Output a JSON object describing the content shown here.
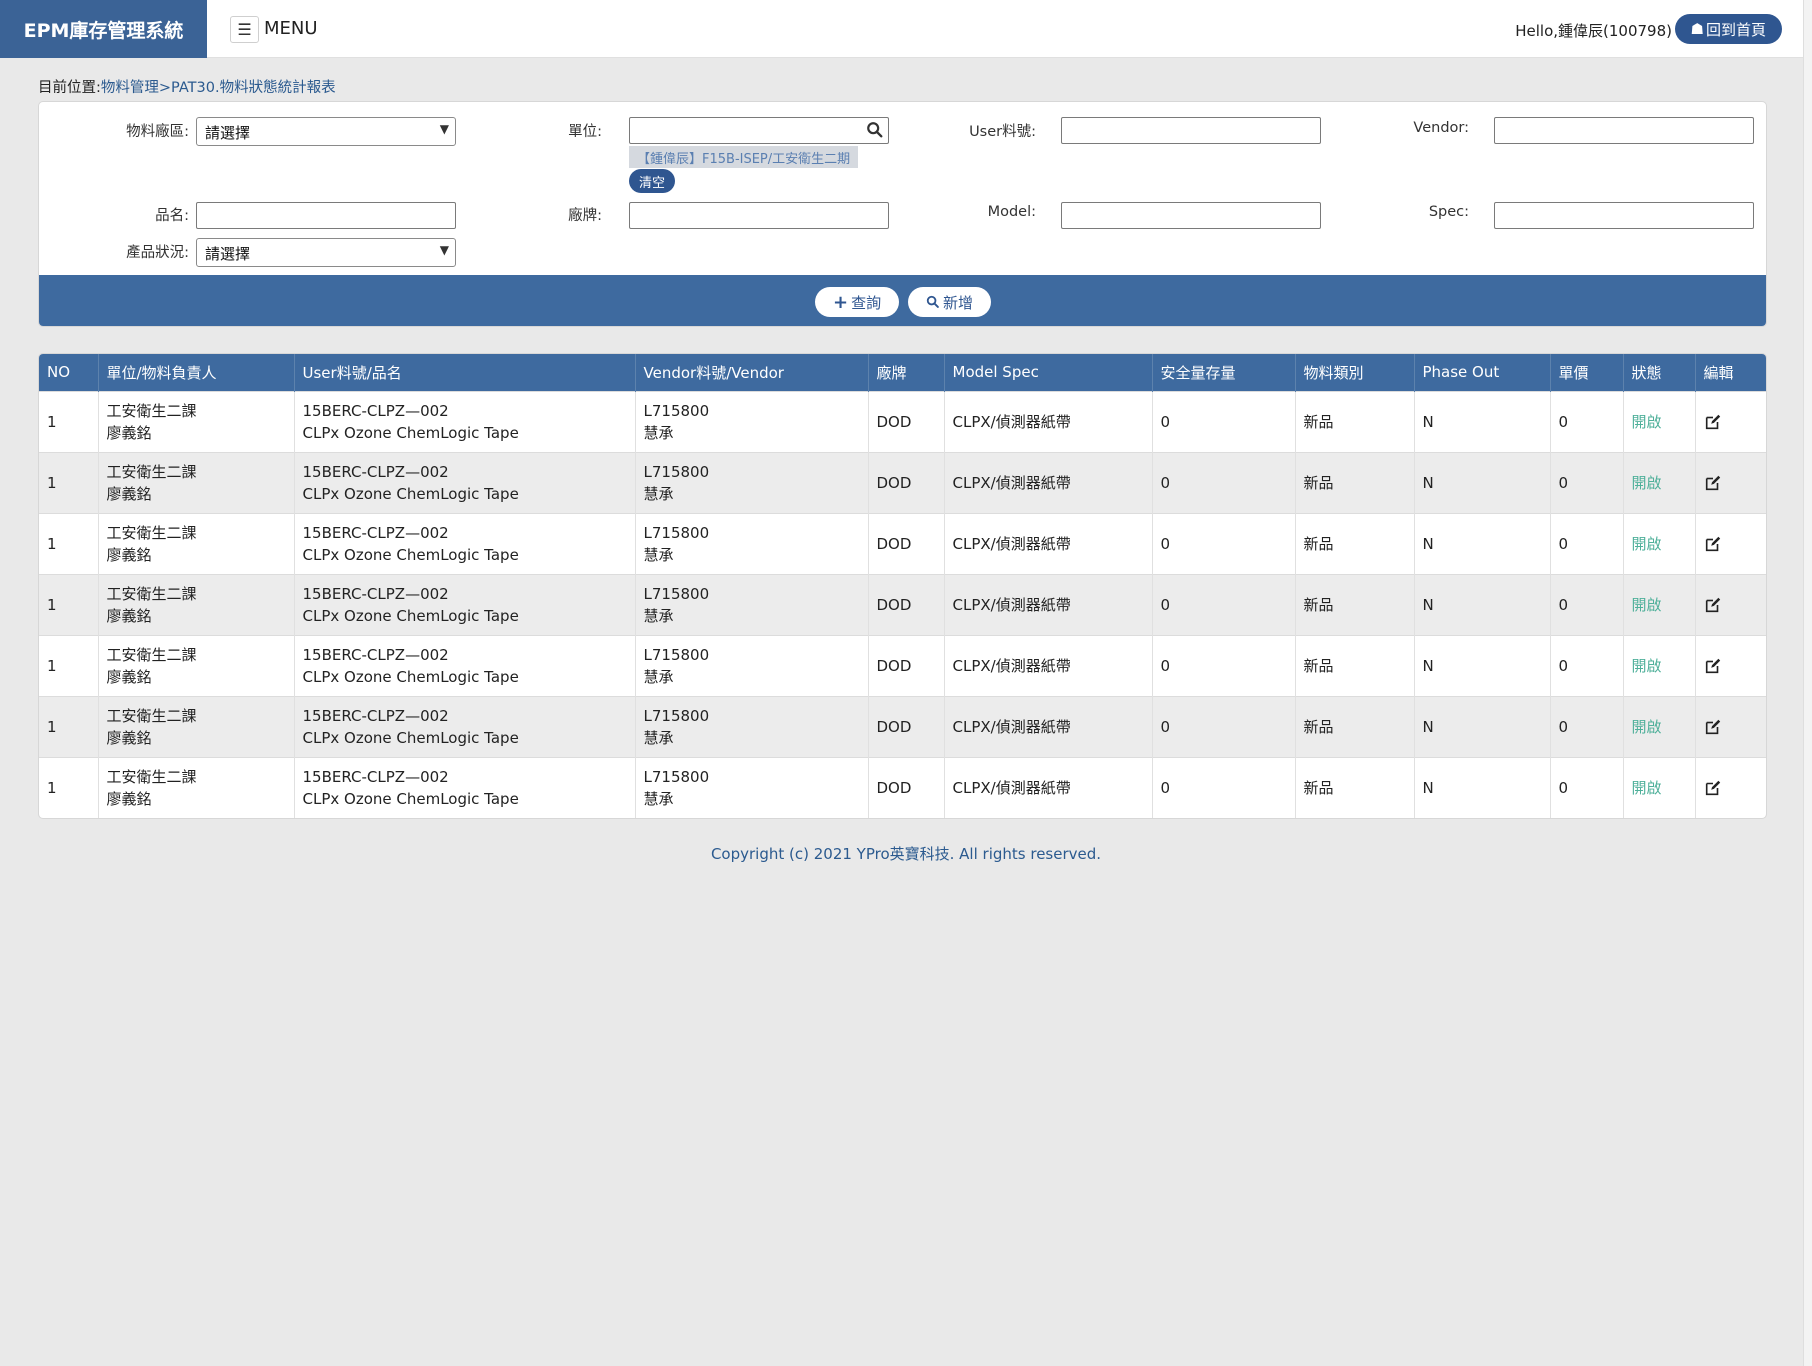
{
  "header": {
    "brand": "EPM庫存管理系統",
    "menu_icon": "hamburger-icon",
    "menu_label": "MENU",
    "hello": "Hello,鍾偉辰(100798)",
    "home_label": "回到首頁",
    "home_icon": "home-icon"
  },
  "breadcrumb": {
    "prefix": "目前位置:",
    "path": "物料管理>PAT30.物料狀態統計報表"
  },
  "filters": {
    "area_label": "物料廠區:",
    "area_value": "請選擇",
    "unit_label": "單位:",
    "unit_value": "",
    "unit_selected": "【鍾偉辰】F15B-ISEP/工安衛生二期",
    "clear_label": "清空",
    "user_no_label": "User料號:",
    "vendor_label": "Vendor:",
    "name_label": "品名:",
    "brand_label": "廠牌:",
    "model_label": "Model:",
    "spec_label": "Spec:",
    "status_label": "產品狀況:",
    "status_value": "請選擇",
    "query_label": "查詢",
    "add_label": "新增"
  },
  "table": {
    "headers": [
      "NO",
      "單位/物料負責人",
      "User料號/品名",
      "Vendor料號/Vendor",
      "廠牌",
      "Model Spec",
      "安全量存量",
      "物料類別",
      "Phase Out",
      "單價",
      "狀態",
      "編輯"
    ],
    "rows": [
      {
        "no": "1",
        "unit": "工安衛生二課",
        "owner": "廖義銘",
        "user_no": "15BERC-CLPZ—002",
        "name": "CLPx Ozone ChemLogic Tape",
        "vendor_no": "L715800",
        "vendor": "慧承",
        "brand": "DOD",
        "model_spec": "CLPX/偵測器紙帶",
        "safety": "0",
        "category": "新品",
        "phase_out": "N",
        "price": "0",
        "status": "開啟"
      },
      {
        "no": "1",
        "unit": "工安衛生二課",
        "owner": "廖義銘",
        "user_no": "15BERC-CLPZ—002",
        "name": "CLPx Ozone ChemLogic Tape",
        "vendor_no": "L715800",
        "vendor": "慧承",
        "brand": "DOD",
        "model_spec": "CLPX/偵測器紙帶",
        "safety": "0",
        "category": "新品",
        "phase_out": "N",
        "price": "0",
        "status": "開啟"
      },
      {
        "no": "1",
        "unit": "工安衛生二課",
        "owner": "廖義銘",
        "user_no": "15BERC-CLPZ—002",
        "name": "CLPx Ozone ChemLogic Tape",
        "vendor_no": "L715800",
        "vendor": "慧承",
        "brand": "DOD",
        "model_spec": "CLPX/偵測器紙帶",
        "safety": "0",
        "category": "新品",
        "phase_out": "N",
        "price": "0",
        "status": "開啟"
      },
      {
        "no": "1",
        "unit": "工安衛生二課",
        "owner": "廖義銘",
        "user_no": "15BERC-CLPZ—002",
        "name": "CLPx Ozone ChemLogic Tape",
        "vendor_no": "L715800",
        "vendor": "慧承",
        "brand": "DOD",
        "model_spec": "CLPX/偵測器紙帶",
        "safety": "0",
        "category": "新品",
        "phase_out": "N",
        "price": "0",
        "status": "開啟"
      },
      {
        "no": "1",
        "unit": "工安衛生二課",
        "owner": "廖義銘",
        "user_no": "15BERC-CLPZ—002",
        "name": "CLPx Ozone ChemLogic Tape",
        "vendor_no": "L715800",
        "vendor": "慧承",
        "brand": "DOD",
        "model_spec": "CLPX/偵測器紙帶",
        "safety": "0",
        "category": "新品",
        "phase_out": "N",
        "price": "0",
        "status": "開啟"
      },
      {
        "no": "1",
        "unit": "工安衛生二課",
        "owner": "廖義銘",
        "user_no": "15BERC-CLPZ—002",
        "name": "CLPx Ozone ChemLogic Tape",
        "vendor_no": "L715800",
        "vendor": "慧承",
        "brand": "DOD",
        "model_spec": "CLPX/偵測器紙帶",
        "safety": "0",
        "category": "新品",
        "phase_out": "N",
        "price": "0",
        "status": "開啟"
      },
      {
        "no": "1",
        "unit": "工安衛生二課",
        "owner": "廖義銘",
        "user_no": "15BERC-CLPZ—002",
        "name": "CLPx Ozone ChemLogic Tape",
        "vendor_no": "L715800",
        "vendor": "慧承",
        "brand": "DOD",
        "model_spec": "CLPX/偵測器紙帶",
        "safety": "0",
        "category": "新品",
        "phase_out": "N",
        "price": "0",
        "status": "開啟"
      }
    ]
  },
  "footer": {
    "copyright": "Copyright (c) 2021 YPro英寶科技. All rights reserved."
  },
  "colors": {
    "brand": "#3b6396",
    "accent": "#3e6a9f",
    "status_open": "#4fb09a"
  }
}
